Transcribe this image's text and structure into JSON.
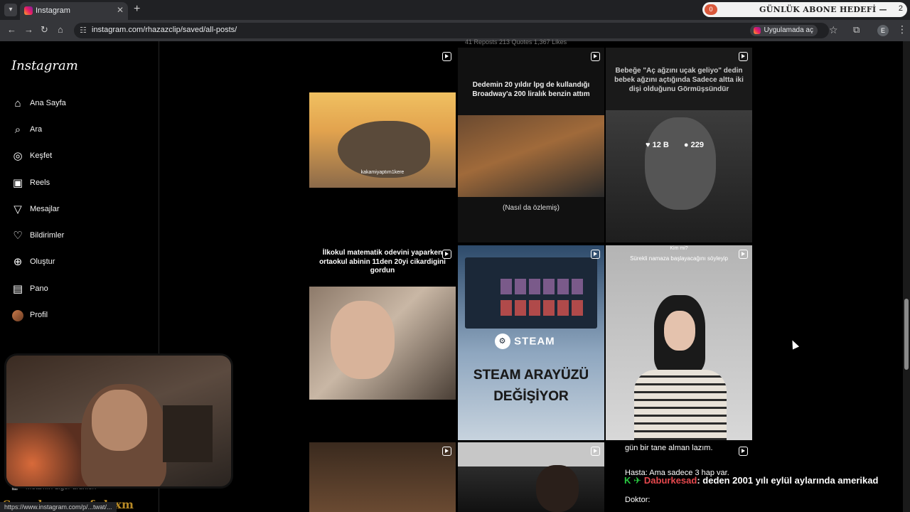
{
  "browser": {
    "tab_title": "Instagram",
    "url": "instagram.com/rhazazclip/saved/all-posts/",
    "open_in_app": "Uygulamada aç",
    "profile_initial": "E"
  },
  "goal_widget": {
    "count": "0",
    "label": "GÜNLÜK ABONE HEDEFİ —",
    "target": "2"
  },
  "sidebar": {
    "logo": "Instagram",
    "items": [
      {
        "label": "Ana Sayfa",
        "icon": "home-icon"
      },
      {
        "label": "Ara",
        "icon": "search-icon"
      },
      {
        "label": "Keşfet",
        "icon": "compass-icon"
      },
      {
        "label": "Reels",
        "icon": "reels-icon"
      },
      {
        "label": "Mesajlar",
        "icon": "send-icon"
      },
      {
        "label": "Bildirimler",
        "icon": "heart-icon"
      },
      {
        "label": "Oluştur",
        "icon": "plus-icon"
      },
      {
        "label": "Pano",
        "icon": "dashboard-icon"
      },
      {
        "label": "Profil",
        "icon": "avatar"
      }
    ],
    "more_label": "Meta'nın diğer ürünleri"
  },
  "grid": {
    "stats_strip": "41 Reposts   213 Quotes   1,367 Likes",
    "tiles": [
      {
        "caption": "",
        "sub": "kakamiyaptım1kere"
      },
      {
        "caption": "Dedemin 20 yıldır lpg de kullandığı Broadway'a 200 liralık benzin attım",
        "sub": "(Nasıl da özlemiş)"
      },
      {
        "caption": "Bebeğe \"Aç ağzını uçak geliyo\" dedin bebek ağzını açtığında Sadece altta iki dişi olduğunu Görmüşsündür",
        "likes": "12 B",
        "comments": "229"
      },
      {
        "caption": "İlkokul matematik odevini yaparken ortaokul abinin 11den 20yi cikardigini gordun"
      },
      {
        "caption": "STEAM ARAYÜZÜ DEĞİŞİYOR",
        "brand": "STEAM"
      },
      {
        "caption": "Kim mi?",
        "sub": "Sürekli namaza başlayacağını söyleyip"
      },
      {
        "caption": ""
      },
      {
        "caption": ""
      },
      {
        "caption": "gün bir tane alman lazım.",
        "sub": "Hasta: Ama sadece 3 hap var.",
        "sub2": "Doktor:"
      }
    ]
  },
  "stream": {
    "overlay_title": "Son abone: mf_dxxm",
    "status_url": "https://www.instagram.com/p/...twat/...",
    "chat_user": "Daburkesad",
    "chat_message": ": deden 2001 yılı eylül aylarında amerikad"
  },
  "colors": {
    "accent": "#e91e63",
    "chat_user": "#e5484d",
    "overlay_gold": "#b88a26"
  }
}
